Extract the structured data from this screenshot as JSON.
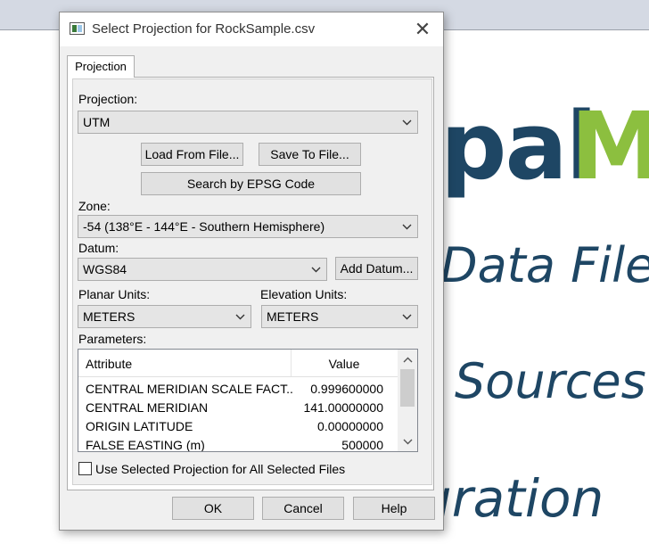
{
  "background": {
    "brand_part1": "pal",
    "brand_part2": "M",
    "line1": "Data Files",
    "line2": "Sources",
    "line3": "uration"
  },
  "dialog": {
    "title": "Select Projection for RockSample.csv",
    "close_glyph": "✕",
    "tab_label": "Projection",
    "projection_label": "Projection:",
    "projection_value": "UTM",
    "load_button": "Load From File...",
    "save_button": "Save To File...",
    "epsg_button": "Search by EPSG Code",
    "zone_label": "Zone:",
    "zone_value": "-54 (138°E - 144°E - Southern Hemisphere)",
    "datum_label": "Datum:",
    "datum_value": "WGS84",
    "add_datum_button": "Add Datum...",
    "planar_units_label": "Planar Units:",
    "planar_units_value": "METERS",
    "elevation_units_label": "Elevation Units:",
    "elevation_units_value": "METERS",
    "parameters_label": "Parameters:",
    "parameters": {
      "columns": [
        "Attribute",
        "Value"
      ],
      "rows": [
        {
          "attribute": "CENTRAL MERIDIAN SCALE FACT...",
          "value": "0.999600000"
        },
        {
          "attribute": "CENTRAL MERIDIAN",
          "value": "141.00000000"
        },
        {
          "attribute": "ORIGIN LATITUDE",
          "value": "0.00000000"
        },
        {
          "attribute": "FALSE EASTING (m)",
          "value": "500000"
        }
      ]
    },
    "use_all_checkbox_label": "Use Selected Projection for All Selected Files",
    "ok_button": "OK",
    "cancel_button": "Cancel",
    "help_button": "Help"
  },
  "colors": {
    "brand_blue": "#1e4664",
    "brand_green": "#8cbf3f",
    "dialog_bg": "#f0f0f0"
  }
}
